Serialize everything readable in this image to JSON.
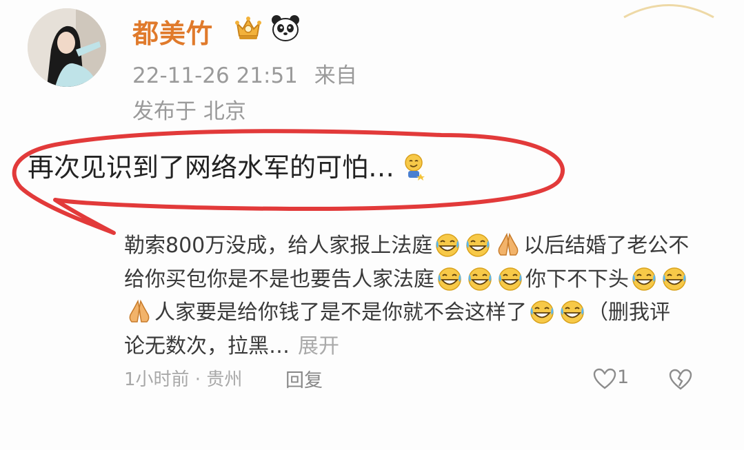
{
  "post": {
    "username": "都美竹",
    "timestamp": "22-11-26 21:51",
    "source_label": "来自",
    "location": "发布于 北京",
    "text": "再次见识到了网络水军的可怕…"
  },
  "comment": {
    "segments": [
      {
        "t": "text",
        "v": "勒索800万没成，给人家报上法庭"
      },
      {
        "t": "emoji",
        "v": "laugh"
      },
      {
        "t": "emoji",
        "v": "laugh"
      },
      {
        "t": "emoji",
        "v": "pray"
      },
      {
        "t": "text",
        "v": "以后结婚了老公不给你买包你是不是也要告人家法庭"
      },
      {
        "t": "emoji",
        "v": "laugh"
      },
      {
        "t": "emoji",
        "v": "laugh"
      },
      {
        "t": "emoji",
        "v": "laugh"
      },
      {
        "t": "text",
        "v": "你下不下头"
      },
      {
        "t": "emoji",
        "v": "laugh"
      },
      {
        "t": "emoji",
        "v": "laugh"
      },
      {
        "t": "emoji",
        "v": "pray"
      },
      {
        "t": "text",
        "v": "人家要是给你钱了是不是你就不会这样了"
      },
      {
        "t": "emoji",
        "v": "laugh"
      },
      {
        "t": "emoji",
        "v": "laugh"
      },
      {
        "t": "text",
        "v": "（删我评论无数次，拉黑…"
      }
    ],
    "expand_label": "展开",
    "time_location": "1小时前 · 贵州",
    "reply_label": "回复",
    "like_count": "1"
  },
  "colors": {
    "username": "#e07a2b",
    "annotation_red": "#e23a3a",
    "meta_gray": "#9a9a9a"
  }
}
